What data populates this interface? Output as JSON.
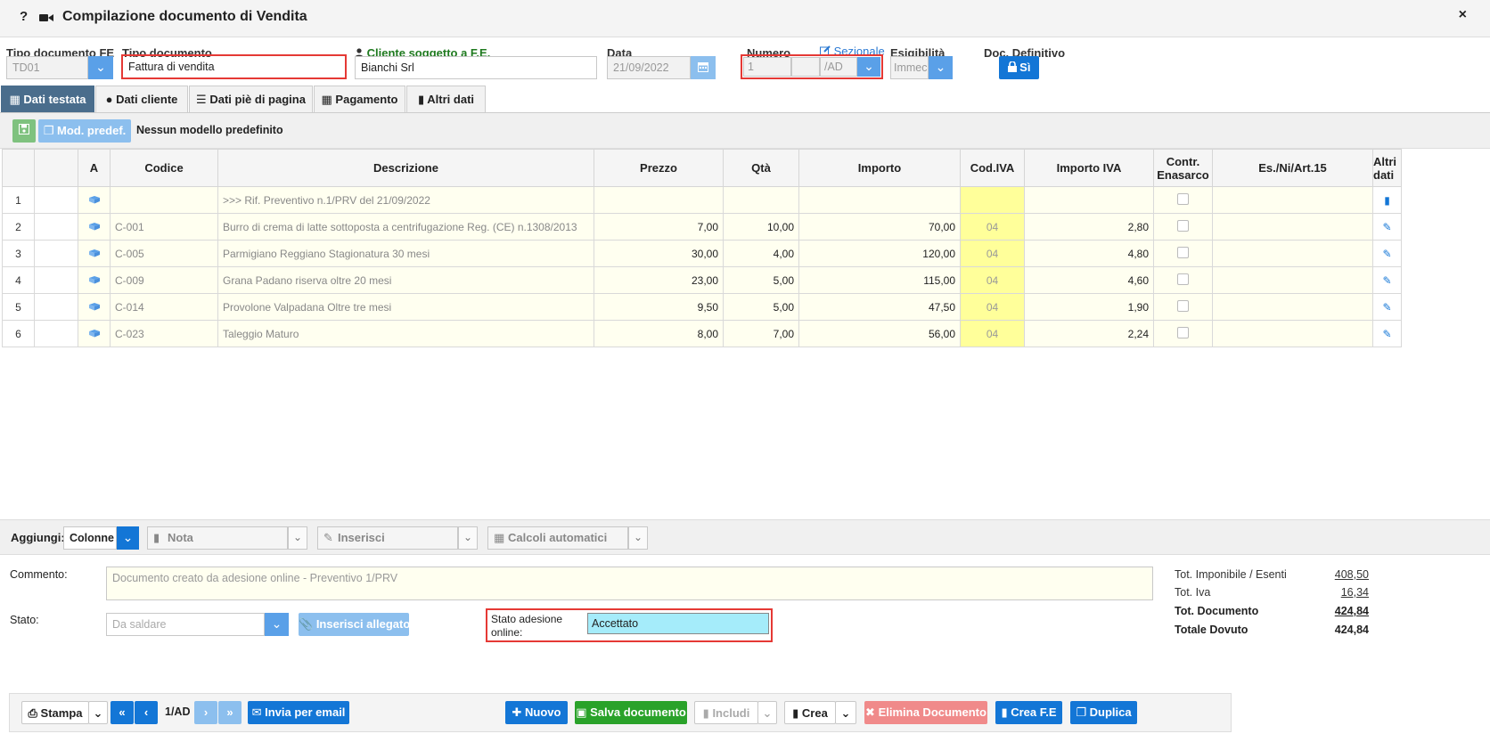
{
  "window": {
    "title": "Compilazione documento di Vendita",
    "help": "?",
    "close": "×"
  },
  "header": {
    "tipo_fe_label": "Tipo documento FE",
    "tipo_fe_value": "TD01",
    "tipo_doc_label": "Tipo documento",
    "tipo_doc_value": "Fattura di vendita",
    "cliente_label": "Cliente soggetto a F.E.",
    "cliente_value": "Bianchi Srl",
    "data_label": "Data",
    "data_value": "21/09/2022",
    "numero_label": "Numero",
    "numero_value": "1",
    "numero_suffix": "/AD",
    "sezionale_link": "Sezionale",
    "esig_label": "Esigibilità",
    "esig_value": "Immec",
    "def_label": "Doc. Definitivo",
    "def_button": "Sì"
  },
  "tabs": [
    "Dati testata",
    "Dati cliente",
    "Dati piè di pagina",
    "Pagamento",
    "Altri dati"
  ],
  "toolbar": {
    "mod_button": "Mod. predef.",
    "mod_text": "Nessun modello predefinito"
  },
  "grid": {
    "columns": [
      "",
      "",
      "A",
      "Codice",
      "Descrizione",
      "Prezzo",
      "Qtà",
      "Importo",
      "Cod.IVA",
      "Importo IVA",
      "Contr. Enasarco",
      "Es./Ni/Art.15",
      "Altri dati"
    ],
    "rows": [
      {
        "n": "1",
        "codice": "",
        "descrizione": ">>> Rif. Preventivo n.1/PRV del 21/09/2022",
        "prezzo": "",
        "qta": "",
        "importo": "",
        "iva": "",
        "importo_iva": ""
      },
      {
        "n": "2",
        "codice": "C-001",
        "descrizione": "Burro di crema di latte sottoposta a centrifugazione Reg. (CE) n.1308/2013",
        "prezzo": "7,00",
        "qta": "10,00",
        "importo": "70,00",
        "iva": "04",
        "importo_iva": "2,80"
      },
      {
        "n": "3",
        "codice": "C-005",
        "descrizione": "Parmigiano Reggiano Stagionatura 30 mesi",
        "prezzo": "30,00",
        "qta": "4,00",
        "importo": "120,00",
        "iva": "04",
        "importo_iva": "4,80"
      },
      {
        "n": "4",
        "codice": "C-009",
        "descrizione": "Grana Padano riserva oltre 20 mesi",
        "prezzo": "23,00",
        "qta": "5,00",
        "importo": "115,00",
        "iva": "04",
        "importo_iva": "4,60"
      },
      {
        "n": "5",
        "codice": "C-014",
        "descrizione": "Provolone Valpadana Oltre tre mesi",
        "prezzo": "9,50",
        "qta": "5,00",
        "importo": "47,50",
        "iva": "04",
        "importo_iva": "1,90"
      },
      {
        "n": "6",
        "codice": "C-023",
        "descrizione": "Taleggio Maturo",
        "prezzo": "8,00",
        "qta": "7,00",
        "importo": "56,00",
        "iva": "04",
        "importo_iva": "2,24"
      }
    ]
  },
  "addbar": {
    "label": "Aggiungi:",
    "colonne": "Colonne",
    "nota": "Nota",
    "inserisci": "Inserisci",
    "calcoli": "Calcoli automatici"
  },
  "footer": {
    "commento_label": "Commento:",
    "commento_value": "Documento creato da adesione online - Preventivo 1/PRV",
    "stato_label": "Stato:",
    "stato_value": "Da saldare",
    "allegato_button": "Inserisci allegato",
    "adesione_label": "Stato adesione online:",
    "adesione_value": "Accettato"
  },
  "totals": {
    "imponibile_label": "Tot. Imponibile / Esenti",
    "imponibile_value": "408,50",
    "iva_label": "Tot. Iva",
    "iva_value": "16,34",
    "documento_label": "Tot. Documento",
    "documento_value": "424,84",
    "dovuto_label": "Totale Dovuto",
    "dovuto_value": "424,84"
  },
  "bottom": {
    "stampa": "Stampa",
    "page": "1/AD",
    "email": "Invia per email",
    "nuovo": "Nuovo",
    "salva": "Salva documento",
    "includi": "Includi",
    "crea": "Crea",
    "elimina": "Elimina Documento",
    "crea_fe": "Crea F.E",
    "duplica": "Duplica"
  }
}
